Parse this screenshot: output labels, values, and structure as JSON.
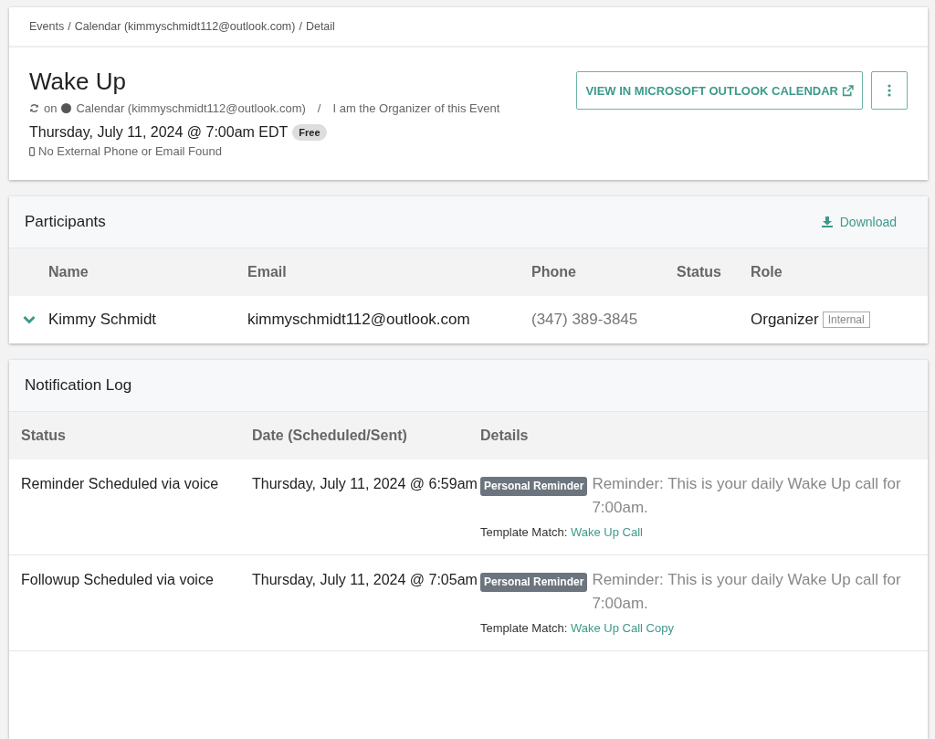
{
  "breadcrumb": [
    "Events",
    "Calendar (kimmyschmidt112@outlook.com)",
    "Detail"
  ],
  "breadcrumb_separator": "/",
  "event": {
    "title": "Wake Up",
    "on_label": "on",
    "calendar": "Calendar (kimmyschmidt112@outlook.com)",
    "separator": "/",
    "role_note": "I am the Organizer of this Event",
    "datetime": "Thursday, July 11, 2024 @ 7:00am EDT",
    "availability": "Free",
    "contact_note": "No External Phone or Email Found"
  },
  "actions": {
    "view_button": "VIEW IN MICROSOFT OUTLOOK CALENDAR"
  },
  "participants": {
    "title": "Participants",
    "download": "Download",
    "columns": [
      "Name",
      "Email",
      "Phone",
      "Status",
      "Role"
    ],
    "rows": [
      {
        "expanded": true,
        "name": "Kimmy Schmidt",
        "email": "kimmyschmidt112@outlook.com",
        "phone": "(347) 389-3845",
        "role": "Organizer",
        "tag": "Internal"
      }
    ]
  },
  "notification_log": {
    "title": "Notification Log",
    "columns": [
      "Status",
      "Date (Scheduled/Sent)",
      "Details"
    ],
    "rows": [
      {
        "status": "Reminder Scheduled via voice",
        "date": "Thursday, July 11, 2024 @ 6:59am",
        "badge": "Personal Reminder",
        "message": "Reminder: This is your daily Wake Up call for 7:00am.",
        "template_label": "Template Match:",
        "template": "Wake Up Call"
      },
      {
        "status": "Followup Scheduled via voice",
        "date": "Thursday, July 11, 2024 @ 7:05am",
        "badge": "Personal Reminder",
        "message": "Reminder: This is your daily Wake Up call for 7:00am.",
        "template_label": "Template Match:",
        "template": "Wake Up Call Copy"
      }
    ]
  }
}
